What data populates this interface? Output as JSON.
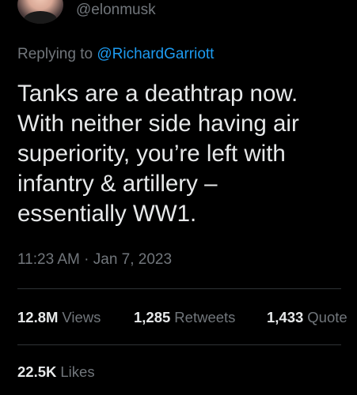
{
  "tweet": {
    "handle": "@elonmusk",
    "replying_prefix": "Replying to",
    "replying_to": "@RichardGarriott",
    "text": "Tanks are a deathtrap now.\nWith neither side having air\nsuperiority, you’re left with\ninfantry & artillery –\nessentially WW1.",
    "time": "11:23 AM",
    "separator": "·",
    "date": "Jan 7, 2023"
  },
  "stats": {
    "views_count": "12.8M",
    "views_label": "Views",
    "retweets_count": "1,285",
    "retweets_label": "Retweets",
    "quotes_count": "1,433",
    "quotes_label": "Quote",
    "likes_count": "22.5K",
    "likes_label": "Likes"
  },
  "colors": {
    "background": "#000000",
    "text_primary": "#e7e9ea",
    "text_secondary": "#71767b",
    "link": "#1d9bf0",
    "divider": "#2f3336"
  }
}
